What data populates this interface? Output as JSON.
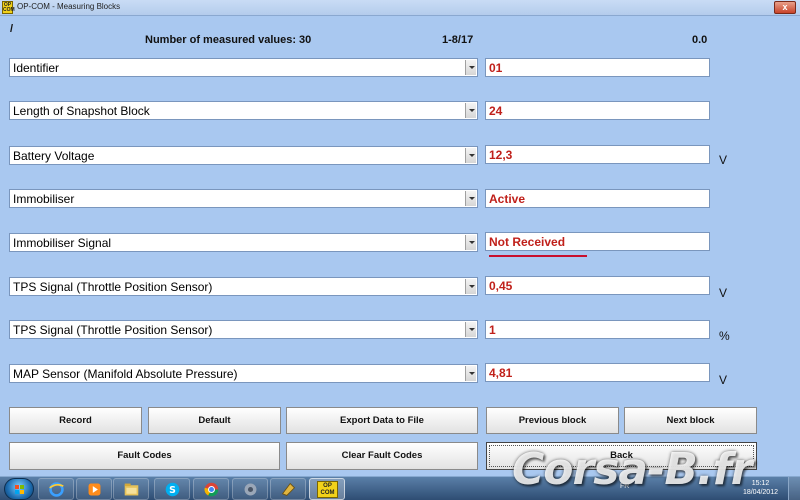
{
  "window": {
    "icon_label": "OP COM",
    "title": "OP-COM - Measuring Blocks",
    "close_label": "x"
  },
  "header": {
    "slash": "/",
    "measured_values": "Number of measured values: 30",
    "range": "1-8/17",
    "value": "0.0"
  },
  "rows": [
    {
      "label": "Identifier",
      "value": "01",
      "unit": ""
    },
    {
      "label": "Length of Snapshot Block",
      "value": "24",
      "unit": ""
    },
    {
      "label": "Battery Voltage",
      "value": "12,3",
      "unit": "V"
    },
    {
      "label": "Immobiliser",
      "value": "Active",
      "unit": ""
    },
    {
      "label": "Immobiliser Signal",
      "value": "Not Received",
      "unit": ""
    },
    {
      "label": "TPS Signal (Throttle Position Sensor)",
      "value": "0,45",
      "unit": "V"
    },
    {
      "label": "TPS Signal (Throttle Position Sensor)",
      "value": "1",
      "unit": "%"
    },
    {
      "label": "MAP Sensor (Manifold Absolute Pressure)",
      "value": "4,81",
      "unit": "V"
    }
  ],
  "buttons": {
    "record": "Record",
    "default": "Default",
    "export": "Export Data to File",
    "previous": "Previous block",
    "next": "Next block",
    "fault_codes": "Fault Codes",
    "clear_fault_codes": "Clear Fault Codes",
    "back": "Back"
  },
  "taskbar": {
    "opcom_label": "OP COM",
    "language": "FR",
    "time": "15:12",
    "date": "18/04/2012",
    "icons": [
      "windows-start-icon",
      "internet-explorer-icon",
      "media-player-icon",
      "file-explorer-icon",
      "skype-icon",
      "chrome-icon",
      "tool-icon",
      "app-icon",
      "op-com-icon"
    ]
  },
  "watermark": "Corsa-B.fr",
  "colors": {
    "background": "#a9c8f0",
    "value_text": "#c0201a",
    "underline": "#c8102e"
  }
}
